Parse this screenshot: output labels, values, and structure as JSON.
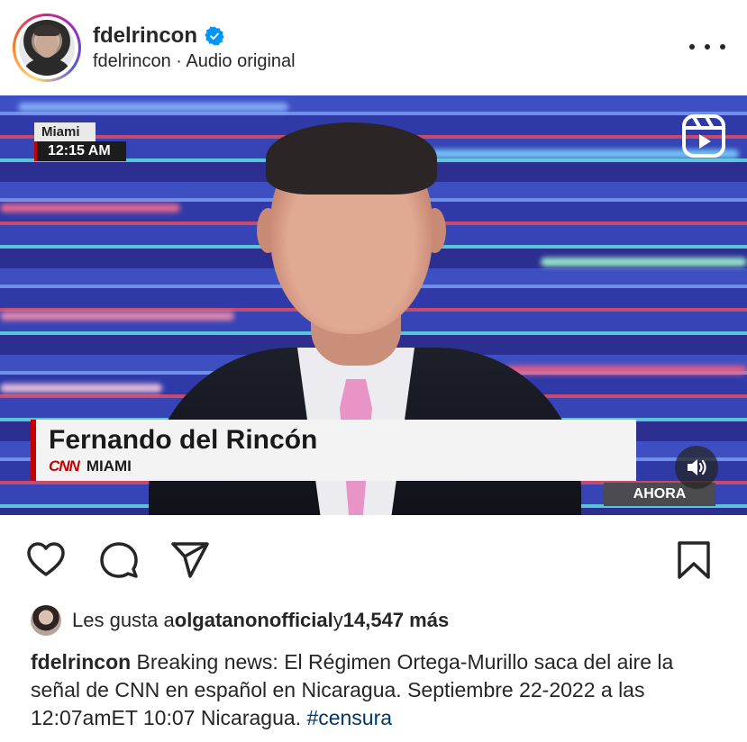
{
  "post": {
    "username": "fdelrincon",
    "author_line": "fdelrincon",
    "separator": " · ",
    "audio": "Audio original"
  },
  "video": {
    "location": "Miami",
    "time": "12:15 AM",
    "lower_third_name": "Fernando del Rincón",
    "network": "CNN",
    "lower_third_location": "MIAMI",
    "ahora": "AHORA"
  },
  "likes": {
    "prefix": "Les gusta a ",
    "user": "olgatanonofficial",
    "middle": " y ",
    "count": "14,547 más"
  },
  "caption": {
    "user": "fdelrincon",
    "text": " Breaking news: El Régimen Ortega-Murillo saca del aire la señal de CNN en español en Nicaragua. Septiembre 22-2022 a las 12:07amET 10:07 Nicaragua. ",
    "hashtag": "#censura"
  },
  "icons": {
    "verified": "verified-badge-icon",
    "more": "more-options-icon",
    "reels": "reels-icon",
    "sound": "sound-on-icon",
    "like": "heart-icon",
    "comment": "comment-icon",
    "share": "send-icon",
    "save": "bookmark-icon"
  },
  "colors": {
    "verified_blue": "#0095f6",
    "cnn_red": "#c40000",
    "hashtag": "#00376b",
    "text": "#262626"
  }
}
